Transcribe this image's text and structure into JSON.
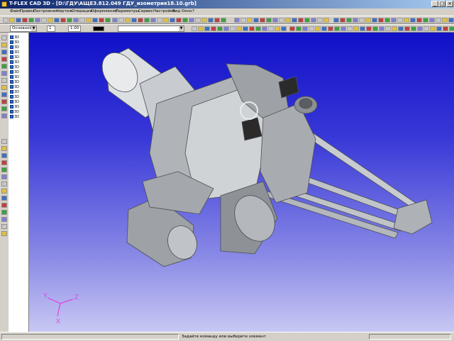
{
  "window": {
    "title": "T-FLEX CAD 3D - [D:\\ГДУ\\АЩЕ3.812.049 ГДУ_изометрия18.10.grb]",
    "min_label": "_",
    "max_label": "□",
    "close_label": "×"
  },
  "menu": {
    "items": [
      "Файл",
      "Правка",
      "Построения",
      "Чертеж",
      "Операции",
      "Оформление",
      "Параметры",
      "Сервис",
      "Настройка",
      "Вид",
      "Окно",
      "?"
    ]
  },
  "toolbar2": {
    "layer_combo": "Основной",
    "number_combo": "1",
    "scale_combo": "1.00"
  },
  "tree": {
    "nodes": [
      "3D",
      "3D",
      "3D",
      "3D",
      "3D",
      "3D",
      "3D",
      "3D",
      "3D",
      "3D",
      "3D",
      "3D",
      "3D",
      "3D",
      "3D",
      "3D",
      "3D"
    ]
  },
  "viewport": {
    "axis_x": "X",
    "axis_y": "Y",
    "axis_z": "Z"
  },
  "status": {
    "message": "Задайте команду или выберите элемент"
  },
  "colors": {
    "title_start": "#0a246a",
    "title_end": "#a6caf0",
    "viewport_top": "#1010c8",
    "viewport_bottom": "#c8c8f4",
    "model_gray": "#b8bcc0",
    "axis_magenta": "#e040e0"
  }
}
